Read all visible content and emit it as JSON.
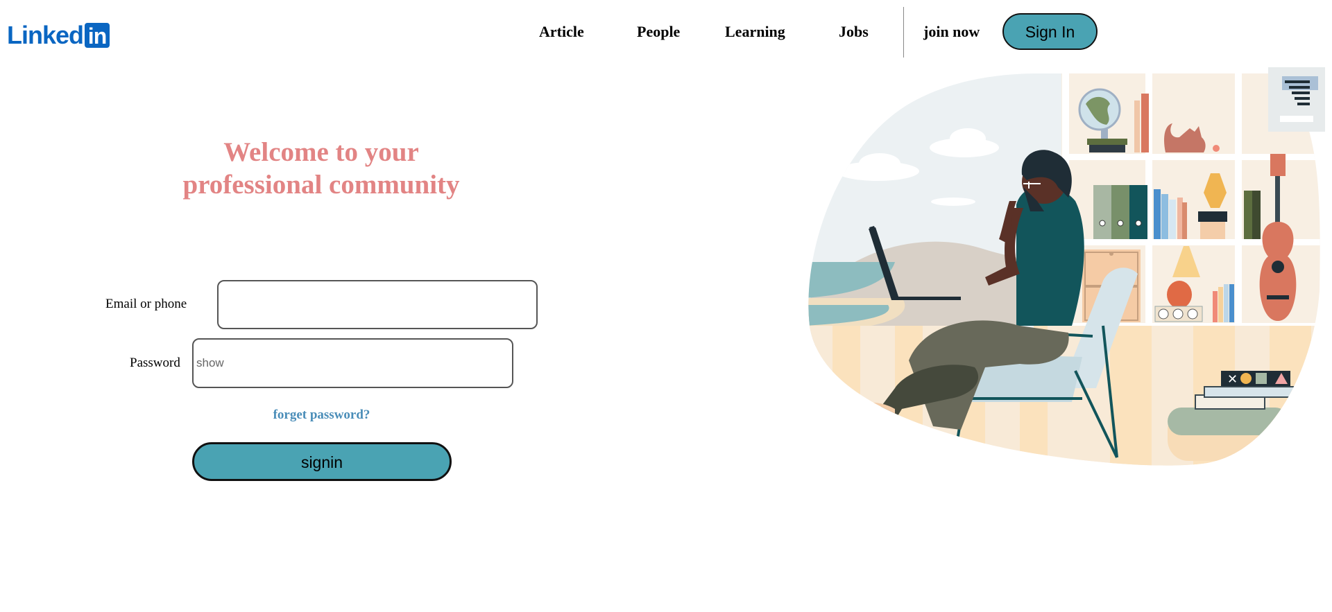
{
  "brand": {
    "logo_text": "Linked",
    "logo_box_text": "in",
    "color": "#0a66c2"
  },
  "nav": {
    "links": [
      "Article",
      "People",
      "Learning",
      "Jobs",
      "join now"
    ],
    "signin_label": "Sign In"
  },
  "hero": {
    "headline_line1": "Welcome to your",
    "headline_line2": "professional community"
  },
  "form": {
    "email_label": "Email or phone",
    "email_value": "",
    "password_label": "Password",
    "password_placeholder": "show",
    "forgot_label": "forget password?",
    "submit_label": "signin"
  },
  "colors": {
    "accent": "#4aa3b3",
    "headline": "#e28484",
    "link": "#4a8db8"
  }
}
